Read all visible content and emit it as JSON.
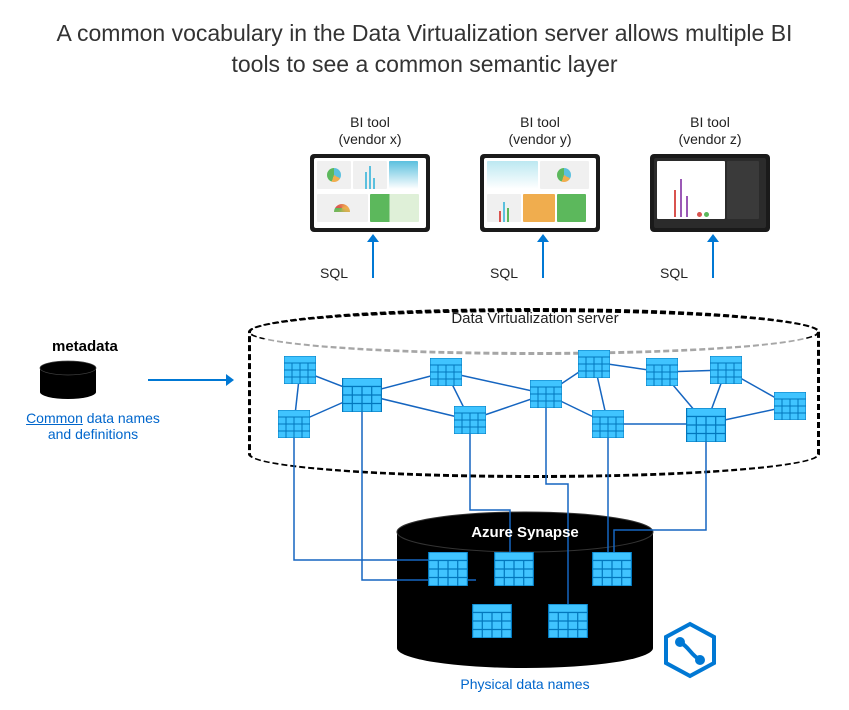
{
  "title": "A common vocabulary in the Data Virtualization server allows multiple BI tools to see a common semantic layer",
  "bi_tools": [
    {
      "label_line1": "BI tool",
      "label_line2": "(vendor x)",
      "sql": "SQL"
    },
    {
      "label_line1": "BI tool",
      "label_line2": "(vendor y)",
      "sql": "SQL"
    },
    {
      "label_line1": "BI tool",
      "label_line2": "(vendor z)",
      "sql": "SQL"
    }
  ],
  "dv_server_label": "Data Virtualization server",
  "metadata": {
    "heading": "metadata",
    "link_underlined": "Common",
    "link_rest": " data names and definitions"
  },
  "synapse": {
    "label": "Azure Synapse",
    "physical_label": "Physical data names"
  },
  "colors": {
    "accent_blue": "#0078d4",
    "table_fill": "#40c4ff",
    "table_stroke": "#0277bd",
    "black": "#000000"
  }
}
